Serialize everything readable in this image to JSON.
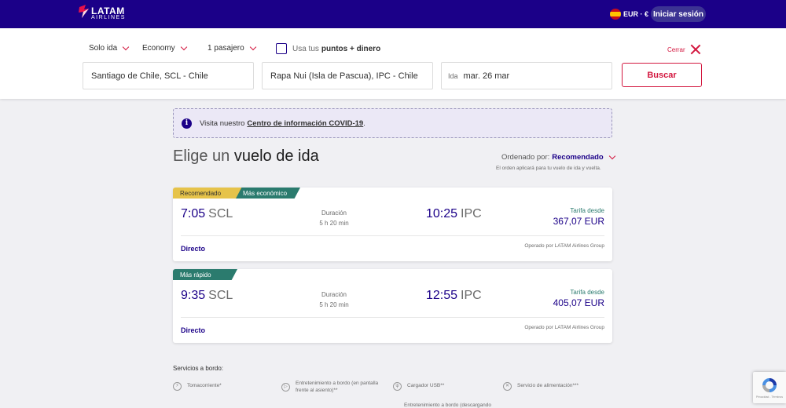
{
  "nav": {
    "logo_top": "LATAM",
    "logo_bottom": "AIRLINES",
    "currency": "EUR · €",
    "login": "Iniciar sesión"
  },
  "search": {
    "trip_type": "Solo ida",
    "cabin": "Economy",
    "passengers": "1 pasajero",
    "points_prefix": "Usa tus",
    "points_bold": "puntos + dinero",
    "close": "Cerrar",
    "origin": "Santiago de Chile, SCL - Chile",
    "destination": "Rapa Nui (Isla de Pascua), IPC - Chile",
    "date_label": "Ida",
    "date_value": "mar. 26 mar",
    "submit": "Buscar"
  },
  "covid": {
    "text": "Visita nuestro",
    "link": "Centro de información COVID-19",
    "end": "."
  },
  "heading": {
    "prefix": "Elige un",
    "bold": "vuelo de ida",
    "sort_label": "Ordenado por:",
    "sort_value": "Recomendado",
    "sort_note": "El orden aplicará para tu vuelo de ida y vuelta."
  },
  "flights": [
    {
      "tags": [
        "Recomendado",
        "Más económico"
      ],
      "dep_time": "7:05",
      "dep_code": "SCL",
      "duration_label": "Duración",
      "duration": "5 h 20 min",
      "arr_time": "10:25",
      "arr_code": "IPC",
      "fare_label": "Tarifa desde",
      "fare": "367,07 EUR",
      "stops": "Directo",
      "operated": "Operado por LATAM Airlines Group"
    },
    {
      "tags": [
        "Más rápido"
      ],
      "dep_time": "9:35",
      "dep_code": "SCL",
      "duration_label": "Duración",
      "duration": "5 h 20 min",
      "arr_time": "12:55",
      "arr_code": "IPC",
      "fare_label": "Tarifa desde",
      "fare": "405,07 EUR",
      "stops": "Directo",
      "operated": "Operado por LATAM Airlines Group"
    }
  ],
  "services": {
    "title": "Servicios a bordo:",
    "items": [
      {
        "icon": "plug-icon",
        "line1": "Tomacorriente*",
        "line2": ""
      },
      {
        "icon": "screen-icon",
        "line1": "Entretenimiento a bordo (en pantalla",
        "line2": "frente al asiento)**"
      },
      {
        "icon": "usb-icon",
        "line1": "Cargador USB**",
        "line2": ""
      },
      {
        "icon": "meal-icon",
        "line1": "Servicio de alimentación***",
        "line2": ""
      }
    ],
    "row2_partial": "Entretenimiento a bordo (descargando"
  },
  "recaptcha": {
    "label": "Privacidad - Términos"
  },
  "colors": {
    "brand_navy": "#1b0088",
    "accent_red": "#d3173f",
    "tag_yellow": "#e6c34a",
    "tag_green": "#2b7b6e"
  }
}
